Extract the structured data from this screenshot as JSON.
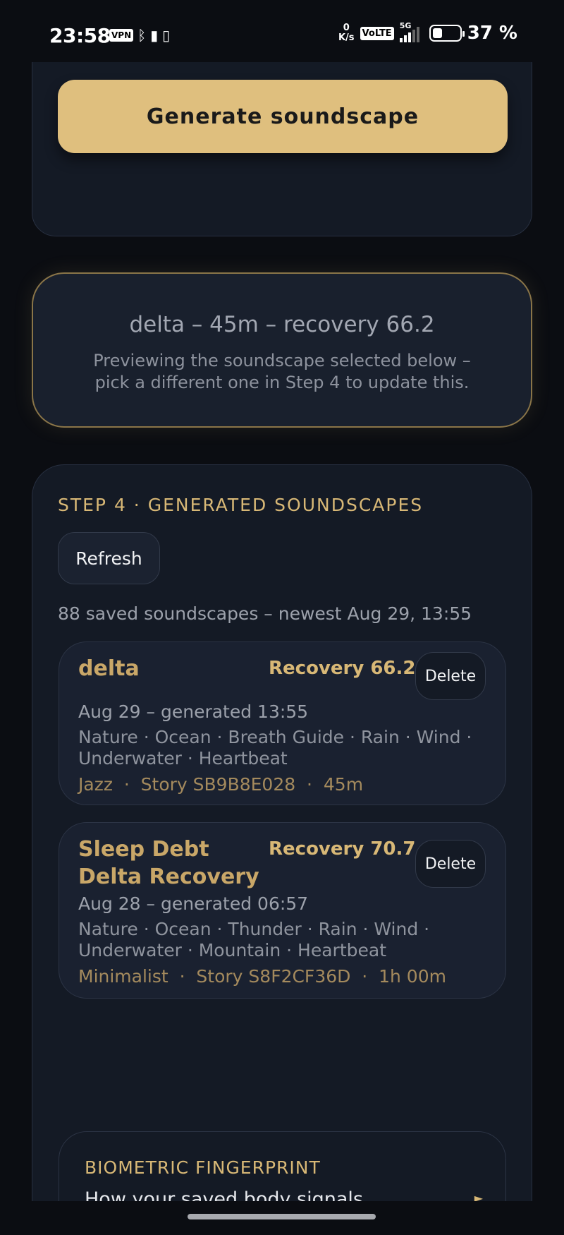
{
  "status_bar": {
    "time": "23:58",
    "vpn": "VPN",
    "net_speed_value": "0",
    "net_speed_unit": "K/s",
    "volte": "VoLTE",
    "network": "5G",
    "battery_level": 0.37,
    "battery_percent": "37 %"
  },
  "generate": {
    "button_label": "Generate soundscape"
  },
  "preview": {
    "title": "delta – 45m – recovery 66.2",
    "subtitle": "Previewing the soundscape selected below – pick a different one in Step 4 to update this."
  },
  "step4": {
    "title": "STEP 4 · GENERATED SOUNDSCAPES",
    "refresh_label": "Refresh",
    "saved_summary": "88 saved soundscapes – newest Aug 29, 13:55",
    "items": [
      {
        "name": "delta",
        "recovery": "Recovery 66.2",
        "delete_label": "Delete",
        "date": "Aug 29 – generated 13:55",
        "tags": "Nature · Ocean · Breath Guide · Rain · Wind · Underwater · Heartbeat",
        "meta": "Jazz  ·  Story SB9B8E028  ·  45m"
      },
      {
        "name": "Sleep Debt Delta Recovery",
        "recovery": "Recovery 70.7",
        "delete_label": "Delete",
        "date": "Aug 28 – generated 06:57",
        "tags": "Nature · Ocean · Thunder · Rain · Wind · Underwater · Mountain · Heartbeat",
        "meta": "Minimalist  ·  Story S8F2CF36D  ·  1h 00m"
      }
    ]
  },
  "fingerprint": {
    "title": "BIOMETRIC FINGERPRINT",
    "description": "How your saved body signals shaped this soundscape",
    "arrow": "►"
  },
  "colors": {
    "accent_gold": "#dfbf7e",
    "background": "#0b0d12",
    "card": "#141a25"
  }
}
